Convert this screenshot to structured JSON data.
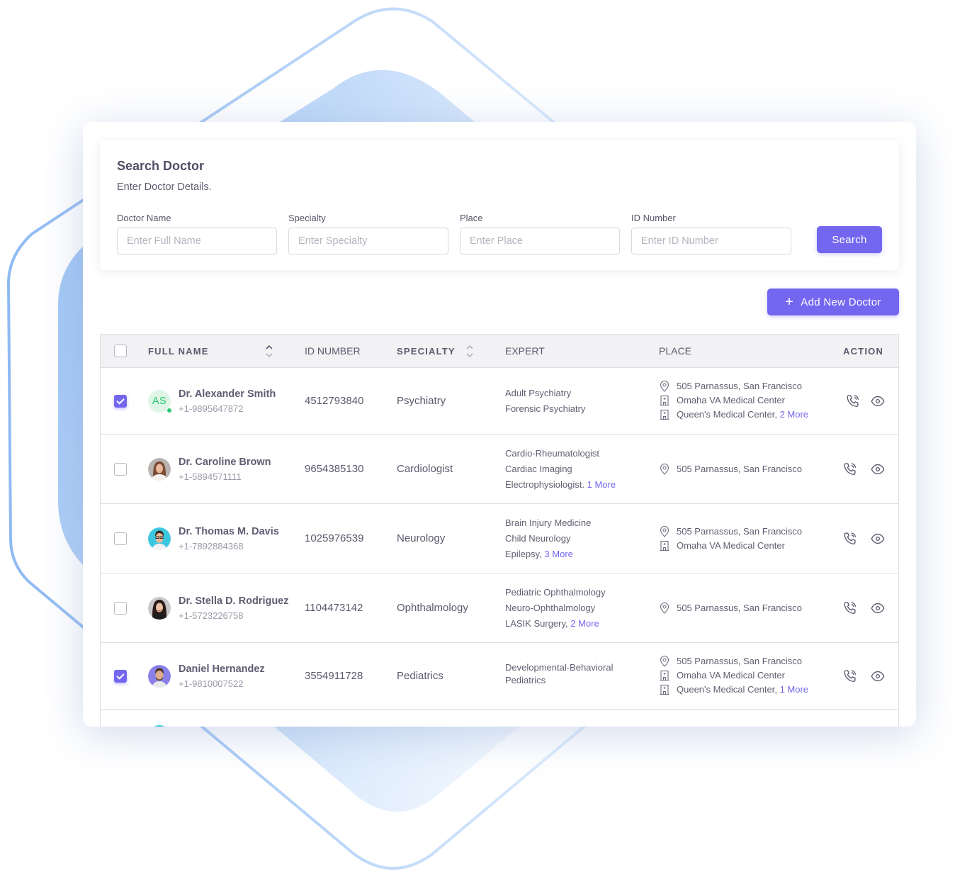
{
  "search": {
    "title": "Search Doctor",
    "subtitle": "Enter Doctor Details.",
    "fields": [
      {
        "label": "Doctor Name",
        "placeholder": "Enter Full Name",
        "value": ""
      },
      {
        "label": "Specialty",
        "placeholder": "Enter Specialty",
        "value": ""
      },
      {
        "label": "Place",
        "placeholder": "Enter Place",
        "value": ""
      },
      {
        "label": "ID Number",
        "placeholder": "Enter ID Number",
        "value": ""
      }
    ],
    "button_label": "Search"
  },
  "add_button": {
    "icon": "plus-icon",
    "label": "Add New Doctor"
  },
  "colors": {
    "accent": "#7367f0",
    "online": "#28c76f",
    "link": "#7367f0"
  },
  "table": {
    "headers": {
      "full_name": "FULL NAME",
      "id_number": "ID NUMBER",
      "specialty": "SPECIALTY",
      "expert": "EXPERT",
      "place": "PLACE",
      "action": "ACTION"
    },
    "rows": [
      {
        "checked": true,
        "avatar": {
          "type": "initials",
          "initials": "AS",
          "online": true
        },
        "name": "Dr. Alexander Smith",
        "phone": "+1-9895647872",
        "id_number": "4512793840",
        "specialty": "Psychiatry",
        "expert": [
          "Adult Psychiatry",
          "Forensic Psychiatry"
        ],
        "expert_more": "",
        "places": [
          {
            "icon": "location-pin-icon",
            "text": "505 Parnassus, San Francisco",
            "more": ""
          },
          {
            "icon": "hospital-building-icon",
            "text": "Omaha VA Medical Center",
            "more": ""
          },
          {
            "icon": "hospital-building-icon",
            "text": "Queen's Medical Center,",
            "more": "2 More"
          }
        ]
      },
      {
        "checked": false,
        "avatar": {
          "type": "photo",
          "tone": "female-brown-hair"
        },
        "name": "Dr. Caroline Brown",
        "phone": "+1-5894571111",
        "id_number": "9654385130",
        "specialty": "Cardiologist",
        "expert": [
          "Cardio-Rheumatologist",
          "Cardiac Imaging",
          "Electrophysiologist."
        ],
        "expert_more": "1 More",
        "places": [
          {
            "icon": "location-pin-icon",
            "text": "505 Parnassus, San Francisco",
            "more": ""
          }
        ]
      },
      {
        "checked": false,
        "avatar": {
          "type": "photo",
          "tone": "male-glasses-cyan"
        },
        "name": "Dr. Thomas M. Davis",
        "phone": "+1-7892884368",
        "id_number": "1025976539",
        "specialty": "Neurology",
        "expert": [
          "Brain Injury Medicine",
          "Child Neurology",
          "Epilepsy,"
        ],
        "expert_more": "3 More",
        "places": [
          {
            "icon": "location-pin-icon",
            "text": "505 Parnassus, San Francisco",
            "more": ""
          },
          {
            "icon": "hospital-building-icon",
            "text": "Omaha VA Medical Center",
            "more": ""
          }
        ]
      },
      {
        "checked": false,
        "avatar": {
          "type": "photo",
          "tone": "female-dark-hair"
        },
        "name": "Dr. Stella D. Rodriguez",
        "phone": "+1-5723226758",
        "id_number": "1104473142",
        "specialty": "Ophthalmology",
        "expert": [
          "Pediatric Ophthalmology",
          "Neuro-Ophthalmology",
          "LASIK Surgery,"
        ],
        "expert_more": "2 More",
        "places": [
          {
            "icon": "location-pin-icon",
            "text": "505 Parnassus, San Francisco",
            "more": ""
          }
        ]
      },
      {
        "checked": true,
        "avatar": {
          "type": "photo",
          "tone": "male-beard-purple"
        },
        "name": "Daniel Hernandez",
        "phone": "+1-9810007522",
        "id_number": "3554911728",
        "specialty": "Pediatrics",
        "expert": [
          "Developmental-Behavioral",
          "Pediatrics"
        ],
        "expert_more": "",
        "places": [
          {
            "icon": "location-pin-icon",
            "text": "505 Parnassus, San Francisco",
            "more": ""
          },
          {
            "icon": "hospital-building-icon",
            "text": "Omaha VA Medical Center",
            "more": ""
          },
          {
            "icon": "hospital-building-icon",
            "text": "Queen's Medical Center,",
            "more": "1 More"
          }
        ]
      }
    ],
    "actions": [
      {
        "icon": "phone-call-icon",
        "label": "Call"
      },
      {
        "icon": "eye-icon",
        "label": "View"
      }
    ]
  }
}
